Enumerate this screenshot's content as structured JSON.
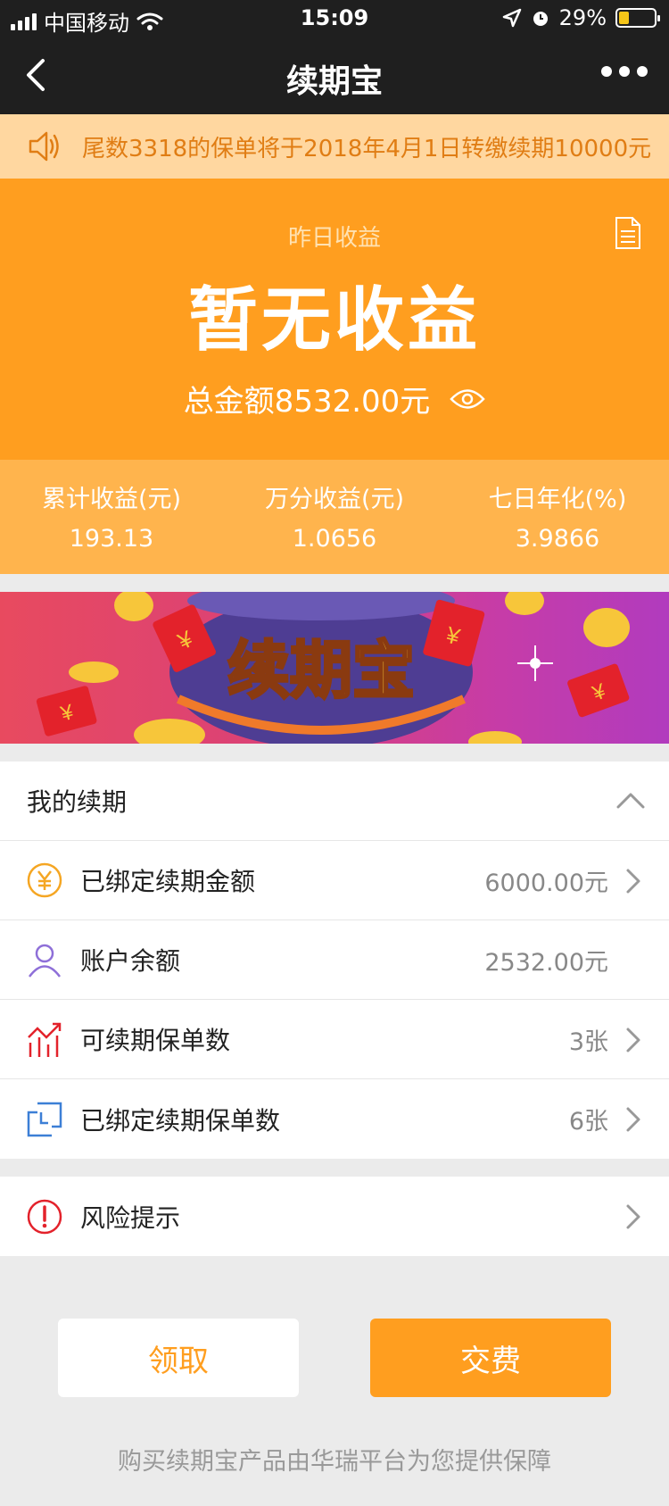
{
  "status_bar": {
    "carrier": "中国移动",
    "time": "15:09",
    "battery": "29%",
    "battery_level": 0.29
  },
  "nav": {
    "title": "续期宝",
    "back_icon": "chevron-left-icon",
    "more_icon": "more-horizontal-icon"
  },
  "notice": {
    "text": "尾数3318的保单将于2018年4月1日转缴续期10000元",
    "icon": "speaker-icon"
  },
  "summary": {
    "label": "昨日收益",
    "headline": "暂无收益",
    "total": "总金额8532.00元"
  },
  "stats": [
    {
      "label": "累计收益(元)",
      "value": "193.13"
    },
    {
      "label": "万分收益(元)",
      "value": "1.0656"
    },
    {
      "label": "七日年化(%)",
      "value": "3.9866"
    }
  ],
  "banner": {
    "title": "续期宝",
    "packet_glyph": "¥"
  },
  "my_renewal": {
    "header": "我的续期",
    "rows": [
      {
        "label": "已绑定续期金额",
        "value": "6000.00元",
        "icon": "yuan-coin-icon"
      },
      {
        "label": "账户余额",
        "value": "2532.00元",
        "icon": "person-icon"
      },
      {
        "label": "可续期保单数",
        "value": "3张",
        "icon": "trend-chart-icon"
      },
      {
        "label": "已绑定续期保单数",
        "value": "6张",
        "icon": "linked-squares-icon"
      }
    ]
  },
  "risk": {
    "label": "风险提示",
    "icon": "exclamation-circle-icon"
  },
  "buttons": {
    "claim": "领取",
    "pay": "交费"
  },
  "footer": "购买续期宝产品由华瑞平台为您提供保障",
  "colors": {
    "orange": "#ff9e1f",
    "light_orange": "#ffb44d",
    "notice_bg": "#ffd7a0",
    "dark_bar": "#1f1f1f"
  }
}
